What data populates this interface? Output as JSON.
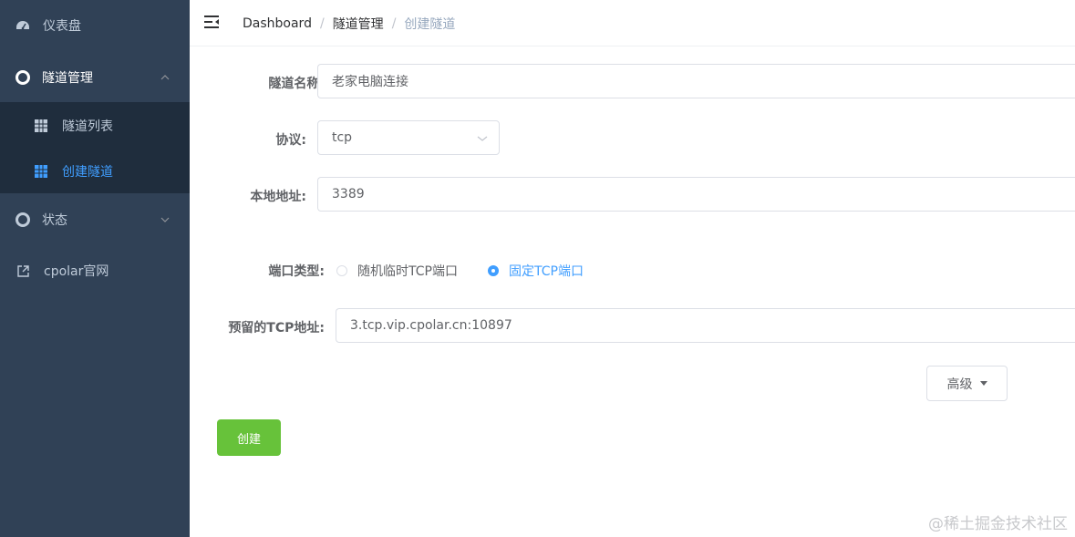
{
  "sidebar": {
    "dashboard_label": "仪表盘",
    "tunnel_mgmt_label": "隧道管理",
    "tunnel_list_label": "隧道列表",
    "create_tunnel_label": "创建隧道",
    "status_label": "状态",
    "cpolar_site_label": "cpolar官网",
    "colors": {
      "bg": "#304156",
      "submenu_bg": "#1f2d3d",
      "text": "#bfcbd9",
      "active": "#409eff"
    }
  },
  "header": {
    "breadcrumb": [
      "Dashboard",
      "隧道管理",
      "创建隧道"
    ],
    "separator": "/"
  },
  "form": {
    "name_label": "隧道名称:",
    "name_value": "老家电脑连接",
    "protocol_label": "协议:",
    "protocol_value": "tcp",
    "local_addr_label": "本地地址:",
    "local_addr_value": "3389",
    "port_type_label": "端口类型:",
    "port_type_options": [
      "随机临时TCP端口",
      "固定TCP端口"
    ],
    "port_type_selected": "固定TCP端口",
    "reserved_addr_label": "预留的TCP地址:",
    "reserved_addr_value": "3.tcp.vip.cpolar.cn:10897",
    "advanced_label": "高级",
    "create_label": "创建"
  },
  "watermark": "@稀土掘金技术社区",
  "colors": {
    "primary": "#409eff",
    "success": "#67c23a"
  }
}
